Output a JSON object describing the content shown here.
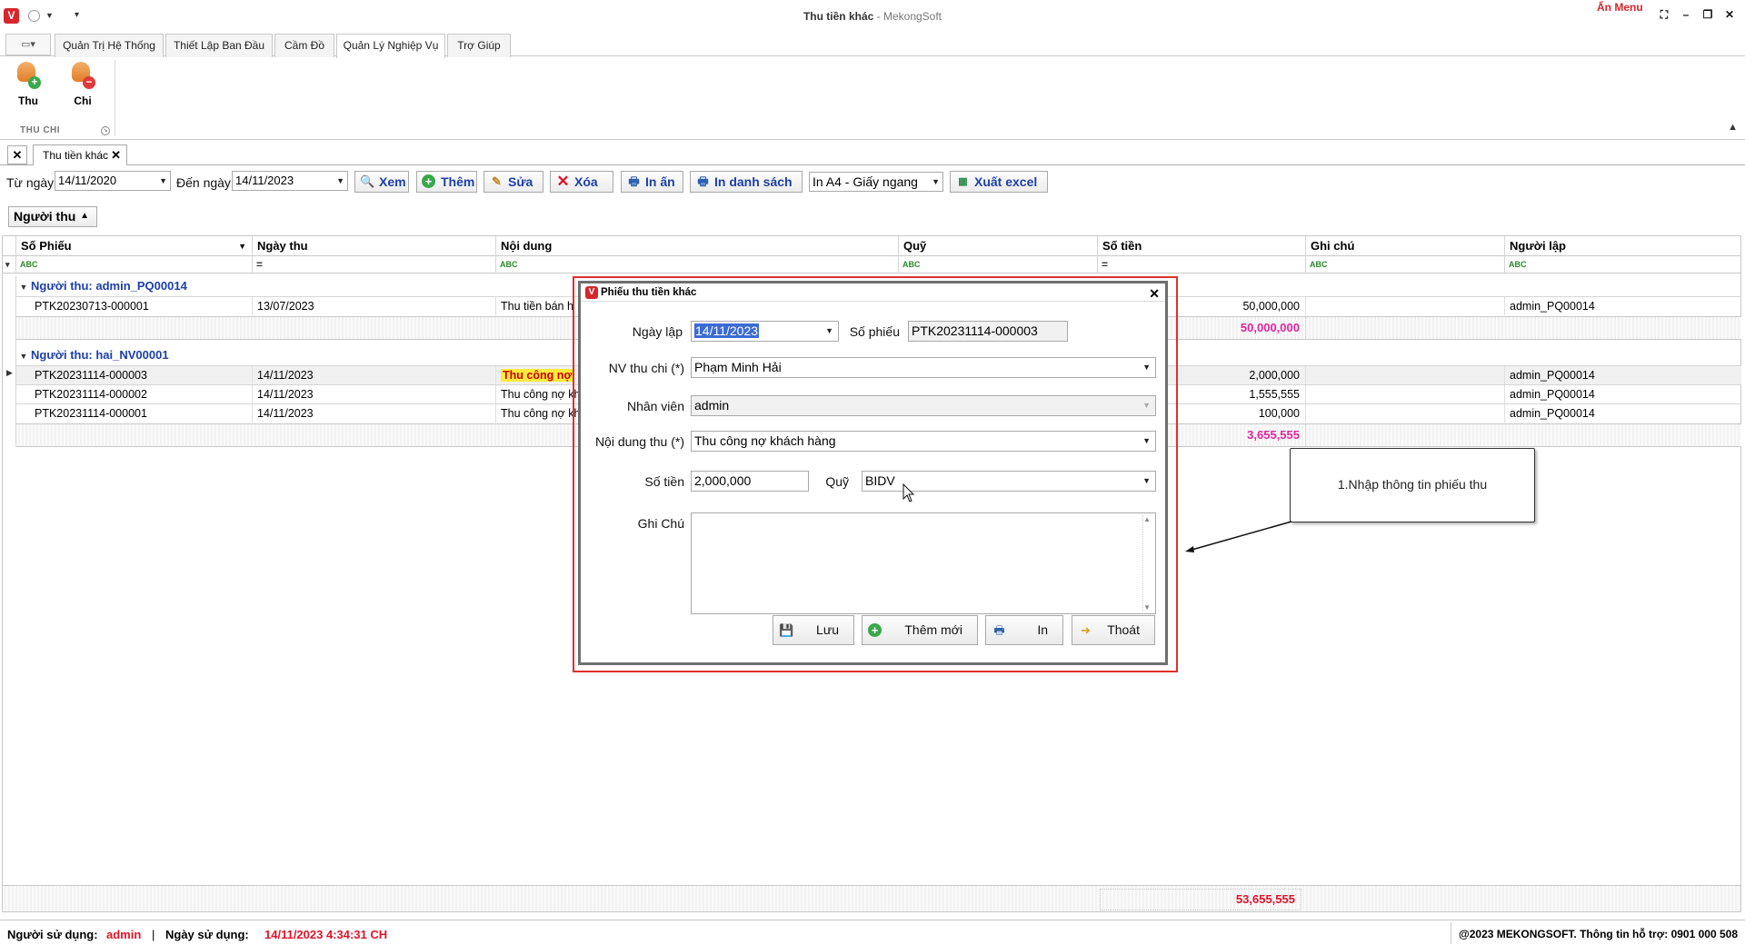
{
  "window": {
    "title": "Thu tiền khác",
    "title_suffix": " - MekongSoft",
    "hide_menu": "Ẩn Menu"
  },
  "ribbon": {
    "tabs": [
      "Quản Trị Hệ Thống",
      "Thiết Lập Ban Đầu",
      "Cầm Đồ",
      "Quản Lý Nghiệp Vụ",
      "Trợ Giúp"
    ],
    "active_tab": "Quản Lý Nghiệp Vụ",
    "buttons": {
      "thu": "Thu",
      "chi": "Chi"
    },
    "group_label": "THU CHI"
  },
  "doc_tab": {
    "label": "Thu tiền khác"
  },
  "toolbar": {
    "from_label": "Từ ngày",
    "from_value": "14/11/2020",
    "to_label": "Đến ngày",
    "to_value": "14/11/2023",
    "view": "Xem",
    "add": "Thêm",
    "edit": "Sửa",
    "delete": "Xóa",
    "print": "In ấn",
    "print_list": "In danh sách",
    "paper": "In A4 - Giấy ngang",
    "export": "Xuất excel"
  },
  "group_by": "Người thu",
  "grid": {
    "columns": [
      "Số Phiếu",
      "Ngày thu",
      "Nội dung",
      "Quỹ",
      "Số tiền",
      "Ghi chú",
      "Người lập"
    ],
    "filter_eq": "=",
    "filter_abc": "ABC",
    "groups": [
      {
        "label": "Người thu: admin_PQ00014",
        "rows": [
          {
            "so_phieu": "PTK20230713-000001",
            "ngay": "13/07/2023",
            "noi_dung": "Thu tiền bán h",
            "so_tien": "50,000,000",
            "nguoi_lap": "admin_PQ00014"
          }
        ],
        "total": "50,000,000"
      },
      {
        "label": "Người thu: hai_NV00001",
        "rows": [
          {
            "so_phieu": "PTK20231114-000003",
            "ngay": "14/11/2023",
            "noi_dung": "Thu công nợ",
            "so_tien": "2,000,000",
            "nguoi_lap": "admin_PQ00014"
          },
          {
            "so_phieu": "PTK20231114-000002",
            "ngay": "14/11/2023",
            "noi_dung": "Thu công nợ kh",
            "so_tien": "1,555,555",
            "nguoi_lap": "admin_PQ00014"
          },
          {
            "so_phieu": "PTK20231114-000001",
            "ngay": "14/11/2023",
            "noi_dung": "Thu công nợ kh",
            "so_tien": "100,000",
            "nguoi_lap": "admin_PQ00014"
          }
        ],
        "total": "3,655,555"
      }
    ],
    "grand_total": "53,655,555"
  },
  "dialog": {
    "title": "Phiếu thu tiền khác",
    "ngay_lap_label": "Ngày lập",
    "ngay_lap": "14/11/2023",
    "so_phieu_label": "Số phiếu",
    "so_phieu": "PTK20231114-000003",
    "nv_thu_chi_label": "NV thu chi (*)",
    "nv_thu_chi": "Phạm Minh Hải",
    "nhan_vien_label": "Nhân viên",
    "nhan_vien": "admin",
    "noi_dung_label": "Nội dung thu (*)",
    "noi_dung": "Thu công nợ khách hàng",
    "so_tien_label": "Số tiền",
    "so_tien": "2,000,000",
    "quy_label": "Quỹ",
    "quy": "BIDV",
    "ghi_chu_label": "Ghi Chú",
    "save": "Lưu",
    "add_new": "Thêm mới",
    "print": "In",
    "exit": "Thoát"
  },
  "callout": "1.Nhập thông tin phiếu thu",
  "status": {
    "user_label": "Người sử dụng:",
    "user": "admin",
    "sep": "|",
    "date_label": "Ngày sử dụng:",
    "date": "14/11/2023 4:34:31 CH",
    "copyright": "@2023 MEKONGSOFT. Thông tin hỗ trợ: 0901 000 508"
  }
}
